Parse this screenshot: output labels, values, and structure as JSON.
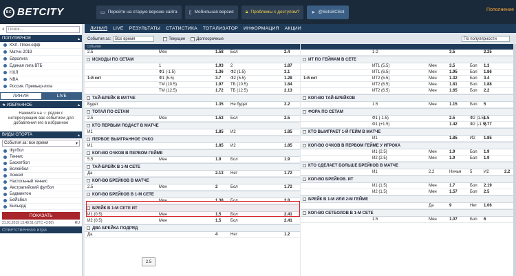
{
  "brand": "BETCITY",
  "top_buttons": [
    {
      "label": "Перейти на старую версию сайта",
      "icon": "monitor-icon"
    },
    {
      "label": "Мобильная версия",
      "icon": "phone-icon"
    },
    {
      "label": "Проблемы с доступом?",
      "icon": "lock-icon"
    },
    {
      "label": "@BetsBCBot",
      "icon": "telegram-icon"
    }
  ],
  "deposit": "Пополнение",
  "search_placeholder": "Поиск...",
  "popular_header": "ПОПУЛЯРНОЕ",
  "popular_items": [
    "КХЛ. Плей-офф",
    "Матчи 2019",
    "Евролига",
    "Единая лига ВТБ",
    "НХЛ",
    "NBA",
    "Россия. Премьер-лига"
  ],
  "tab_line": "ЛИНИЯ",
  "tab_live": "LIVE",
  "favorites_header": "ИЗБРАННОЕ",
  "fav_note": "Нажмите на ☆ рядом с интересующим вас событием для добавления его в избранное",
  "sports_header": "ВИДЫ СПОРТА",
  "sports_select": "События за: все время",
  "sports": [
    "Футбол",
    "Теннис",
    "Баскетбол",
    "Волейбол",
    "Хоккей",
    "Настольный теннис",
    "Австралийский футбол",
    "Бадминтон",
    "БеЙсбол",
    "Бильярд"
  ],
  "show_button": "ПОКАЗАТЬ",
  "sidebar_date": "21.01.2019 13:48:51 (UTC +3:00)",
  "sidebar_lang": "RU",
  "responsible": "Ответственная игра",
  "nav": [
    "ЛИНИЯ",
    "LIVE",
    "РЕЗУЛЬТАТЫ",
    "СТАТИСТИКА",
    "ТОТАЛИЗАТОР",
    "ИНФОРМАЦИЯ",
    "АКЦИИ"
  ],
  "filter": {
    "label": "События за:",
    "value": "Все время",
    "current": "Текущие",
    "long": "Долгосрочные",
    "sort": "По популярности"
  },
  "tooltip": "2.5",
  "left": {
    "head": "События",
    "first_row": {
      "a": "2.5",
      "b": "Мен",
      "c": "1.58",
      "d": "Бол",
      "e": "2.4"
    },
    "sections": [
      {
        "title": "ИСХОДЫ ПО СЕТАМ",
        "label": "1-й сет",
        "rows": [
          {
            "a": "",
            "b": "1",
            "c": "1.93",
            "d": "2",
            "e": "1.87"
          },
          {
            "a": "",
            "b": "Ф1 (-1.5)",
            "c": "1.36",
            "d": "Ф2 (1.5)",
            "e": "3.1"
          },
          {
            "a": "",
            "b": "Ф1 (5.5)",
            "c": "3.7",
            "d": "Ф2 (5.5)",
            "e": "1.28"
          },
          {
            "a": "",
            "b": "ТМ (10.5)",
            "c": "1.97",
            "d": "ТБ (10.5)",
            "e": "1.84"
          },
          {
            "a": "",
            "b": "ТМ (12.5)",
            "c": "1.72",
            "d": "ТБ (12.5)",
            "e": "2.13"
          }
        ]
      },
      {
        "title": "ТАЙ-БРЕЙК В МАТЧЕ",
        "rows": [
          {
            "a": "Будет",
            "b": "",
            "c": "1.35",
            "d": "Не будет",
            "e": "3.2"
          }
        ]
      },
      {
        "title": "ТОТАЛ ПО СЕТАМ",
        "rows": [
          {
            "a": "2.5",
            "b": "Мен",
            "c": "1.53",
            "d": "Бол",
            "e": "2.5"
          }
        ]
      },
      {
        "title": "КТО ПЕРВЫМ ПОДАСТ В МАТЧЕ",
        "rows": [
          {
            "a": "И1",
            "b": "",
            "c": "1.85",
            "d": "И2",
            "e": "1.85"
          }
        ]
      },
      {
        "title": "ПЕРВОЕ ВЫИГРАННОЕ ОЧКО",
        "rows": [
          {
            "a": "И1",
            "b": "",
            "c": "1.85",
            "d": "И2",
            "e": "1.85"
          }
        ]
      },
      {
        "title": "КОЛ-ВО ОЧКОВ В ПЕРВОМ ГЕЙМЕ",
        "rows": [
          {
            "a": "5.5",
            "b": "Мен",
            "c": "1.9",
            "d": "Бол",
            "e": "1.9"
          }
        ]
      },
      {
        "title": "ТАЙ-БРЕЙК В 1-М СЕТЕ",
        "rows": [
          {
            "a": "Да",
            "b": "",
            "c": "2.13",
            "d": "Нет",
            "e": "1.72"
          }
        ]
      },
      {
        "title": "КОЛ-ВО БРЕЙКОВ В МАТЧЕ",
        "rows": [
          {
            "a": "2.5",
            "b": "Мен",
            "c": "2",
            "d": "Бол",
            "e": "1.72"
          }
        ]
      },
      {
        "title": "КОЛ-ВО БРЕЙКОВ В 1-М СЕТЕ",
        "rows": [
          {
            "a": "",
            "b": "Мен",
            "c": "1.38",
            "d": "Бол",
            "e": "2.8"
          }
        ]
      },
      {
        "title": "БРЕЙК В 1-М СЕТЕ ИТ",
        "rows": [
          {
            "a": "И1 (0.5)",
            "b": "Мен",
            "c": "1.5",
            "d": "Бол",
            "e": "2.41"
          },
          {
            "a": "И2 (0.5)",
            "b": "Мен",
            "c": "1.5",
            "d": "Бол",
            "e": "2.41"
          }
        ]
      },
      {
        "title": "ДВА БРЕЙКА ПОДРЯД",
        "rows": [
          {
            "a": "Да",
            "b": "",
            "c": "4",
            "d": "Нет",
            "e": "1.2"
          }
        ]
      }
    ]
  },
  "right": {
    "cols": [
      "",
      "1",
      "Х",
      "2",
      "Ф1",
      "",
      "Ф2",
      "",
      "ТОТ",
      "М",
      "Б"
    ],
    "first_row": {
      "a": "1-2",
      "c": "3.5",
      "e": "2.25"
    },
    "sections": [
      {
        "title": "ИТ ПО ГЕЙМАМ В СЕТЕ",
        "label": "1-й сет",
        "rows": [
          {
            "a": "ИТ1 (5.5)",
            "b": "Мен",
            "c": "3.5",
            "d": "Бол",
            "e": "1.3"
          },
          {
            "a": "ИТ1 (6.5)",
            "b": "Мен",
            "c": "1.95",
            "d": "Бол",
            "e": "1.86"
          },
          {
            "a": "ИТ2 (5.5)",
            "b": "Мен",
            "c": "1.32",
            "d": "Бол",
            "e": "3.4"
          },
          {
            "a": "ИТ2 (6.5)",
            "b": "Мен",
            "c": "1.81",
            "d": "Бол",
            "e": "1.88"
          },
          {
            "a": "ИТ2 (6.5)",
            "b": "Мен",
            "c": "1.65",
            "d": "Бол",
            "e": "2.2"
          }
        ]
      },
      {
        "title": "КОЛ-ВО ТАЙ-БРЕЙКОВ",
        "rows": [
          {
            "a": "1.5",
            "b": "Мен",
            "c": "1.15",
            "d": "Бол",
            "e": "5"
          }
        ]
      },
      {
        "title": "ФОРА ПО СЕТАМ",
        "rows": [
          {
            "a": "Ф1 (-1.5)",
            "b": "",
            "c": "2.5",
            "d": "Ф2 (1.5)",
            "e": "1.5"
          },
          {
            "a": "Ф1 (+1.5)",
            "b": "",
            "c": "1.42",
            "d": "Ф2 (-1.5)",
            "e": "2.77"
          }
        ]
      },
      {
        "title": "КТО ВЫИГРАЕТ 1-Й ГЕЙМ В МАТЧЕ",
        "rows": [
          {
            "a": "И1",
            "b": "",
            "c": "1.85",
            "d": "И2",
            "e": "1.85"
          }
        ]
      },
      {
        "title": "КОЛ-ВО ОЧКОВ В ПЕРВОМ ГЕЙМЕ У ИГРОКА",
        "rows": [
          {
            "a": "И1 (2.5)",
            "b": "Мен",
            "c": "1.9",
            "d": "Бол",
            "e": "1.9"
          },
          {
            "a": "И2 (2.5)",
            "b": "Мен",
            "c": "1.9",
            "d": "Бол",
            "e": "1.9"
          }
        ]
      },
      {
        "title": "КТО СДЕЛАЕТ БОЛЬШЕ БРЕЙКОВ В МАТЧЕ",
        "rows": [
          {
            "a": "И1",
            "b": "2.2",
            "c": "Ничья",
            "d": "5",
            "e": "И2",
            "f": "2.2"
          }
        ]
      },
      {
        "title": "КОЛ-ВО БРЕЙКОВ. ИТ",
        "rows": [
          {
            "a": "И1 (1.5)",
            "b": "Мен",
            "c": "1.7",
            "d": "Бол",
            "e": "2.19"
          },
          {
            "a": "И2 (1.5)",
            "b": "Мен",
            "c": "1.57",
            "d": "Бол",
            "e": "2.5"
          }
        ]
      },
      {
        "title": "БРЕЙК В 1-М ИЛИ 2-М ГЕЙМЕ",
        "rows": [
          {
            "a": "",
            "b": "Да",
            "c": "9",
            "d": "Нет",
            "e": "1.06"
          }
        ]
      },
      {
        "title": "КОЛ-ВО СЕТБОЛОВ В 1-М СЕТЕ",
        "rows": [
          {
            "a": "1.5",
            "b": "Мен",
            "c": "1.07",
            "d": "Бол",
            "e": "6"
          }
        ]
      }
    ]
  }
}
